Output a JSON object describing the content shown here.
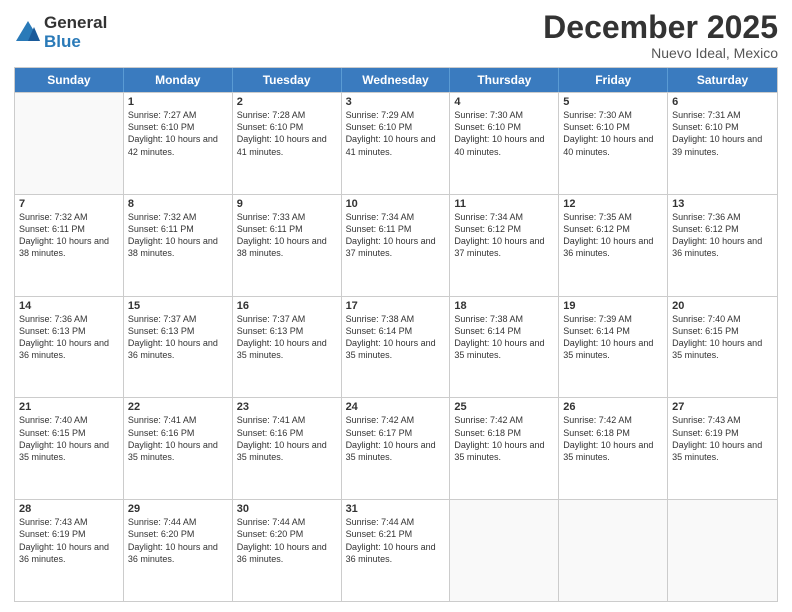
{
  "logo": {
    "general": "General",
    "blue": "Blue"
  },
  "title": "December 2025",
  "subtitle": "Nuevo Ideal, Mexico",
  "days": [
    "Sunday",
    "Monday",
    "Tuesday",
    "Wednesday",
    "Thursday",
    "Friday",
    "Saturday"
  ],
  "weeks": [
    [
      {
        "day": "",
        "info": ""
      },
      {
        "day": "1",
        "info": "Sunrise: 7:27 AM\nSunset: 6:10 PM\nDaylight: 10 hours and 42 minutes."
      },
      {
        "day": "2",
        "info": "Sunrise: 7:28 AM\nSunset: 6:10 PM\nDaylight: 10 hours and 41 minutes."
      },
      {
        "day": "3",
        "info": "Sunrise: 7:29 AM\nSunset: 6:10 PM\nDaylight: 10 hours and 41 minutes."
      },
      {
        "day": "4",
        "info": "Sunrise: 7:30 AM\nSunset: 6:10 PM\nDaylight: 10 hours and 40 minutes."
      },
      {
        "day": "5",
        "info": "Sunrise: 7:30 AM\nSunset: 6:10 PM\nDaylight: 10 hours and 40 minutes."
      },
      {
        "day": "6",
        "info": "Sunrise: 7:31 AM\nSunset: 6:10 PM\nDaylight: 10 hours and 39 minutes."
      }
    ],
    [
      {
        "day": "7",
        "info": "Sunrise: 7:32 AM\nSunset: 6:11 PM\nDaylight: 10 hours and 38 minutes."
      },
      {
        "day": "8",
        "info": "Sunrise: 7:32 AM\nSunset: 6:11 PM\nDaylight: 10 hours and 38 minutes."
      },
      {
        "day": "9",
        "info": "Sunrise: 7:33 AM\nSunset: 6:11 PM\nDaylight: 10 hours and 38 minutes."
      },
      {
        "day": "10",
        "info": "Sunrise: 7:34 AM\nSunset: 6:11 PM\nDaylight: 10 hours and 37 minutes."
      },
      {
        "day": "11",
        "info": "Sunrise: 7:34 AM\nSunset: 6:12 PM\nDaylight: 10 hours and 37 minutes."
      },
      {
        "day": "12",
        "info": "Sunrise: 7:35 AM\nSunset: 6:12 PM\nDaylight: 10 hours and 36 minutes."
      },
      {
        "day": "13",
        "info": "Sunrise: 7:36 AM\nSunset: 6:12 PM\nDaylight: 10 hours and 36 minutes."
      }
    ],
    [
      {
        "day": "14",
        "info": "Sunrise: 7:36 AM\nSunset: 6:13 PM\nDaylight: 10 hours and 36 minutes."
      },
      {
        "day": "15",
        "info": "Sunrise: 7:37 AM\nSunset: 6:13 PM\nDaylight: 10 hours and 36 minutes."
      },
      {
        "day": "16",
        "info": "Sunrise: 7:37 AM\nSunset: 6:13 PM\nDaylight: 10 hours and 35 minutes."
      },
      {
        "day": "17",
        "info": "Sunrise: 7:38 AM\nSunset: 6:14 PM\nDaylight: 10 hours and 35 minutes."
      },
      {
        "day": "18",
        "info": "Sunrise: 7:38 AM\nSunset: 6:14 PM\nDaylight: 10 hours and 35 minutes."
      },
      {
        "day": "19",
        "info": "Sunrise: 7:39 AM\nSunset: 6:14 PM\nDaylight: 10 hours and 35 minutes."
      },
      {
        "day": "20",
        "info": "Sunrise: 7:40 AM\nSunset: 6:15 PM\nDaylight: 10 hours and 35 minutes."
      }
    ],
    [
      {
        "day": "21",
        "info": "Sunrise: 7:40 AM\nSunset: 6:15 PM\nDaylight: 10 hours and 35 minutes."
      },
      {
        "day": "22",
        "info": "Sunrise: 7:41 AM\nSunset: 6:16 PM\nDaylight: 10 hours and 35 minutes."
      },
      {
        "day": "23",
        "info": "Sunrise: 7:41 AM\nSunset: 6:16 PM\nDaylight: 10 hours and 35 minutes."
      },
      {
        "day": "24",
        "info": "Sunrise: 7:42 AM\nSunset: 6:17 PM\nDaylight: 10 hours and 35 minutes."
      },
      {
        "day": "25",
        "info": "Sunrise: 7:42 AM\nSunset: 6:18 PM\nDaylight: 10 hours and 35 minutes."
      },
      {
        "day": "26",
        "info": "Sunrise: 7:42 AM\nSunset: 6:18 PM\nDaylight: 10 hours and 35 minutes."
      },
      {
        "day": "27",
        "info": "Sunrise: 7:43 AM\nSunset: 6:19 PM\nDaylight: 10 hours and 35 minutes."
      }
    ],
    [
      {
        "day": "28",
        "info": "Sunrise: 7:43 AM\nSunset: 6:19 PM\nDaylight: 10 hours and 36 minutes."
      },
      {
        "day": "29",
        "info": "Sunrise: 7:44 AM\nSunset: 6:20 PM\nDaylight: 10 hours and 36 minutes."
      },
      {
        "day": "30",
        "info": "Sunrise: 7:44 AM\nSunset: 6:20 PM\nDaylight: 10 hours and 36 minutes."
      },
      {
        "day": "31",
        "info": "Sunrise: 7:44 AM\nSunset: 6:21 PM\nDaylight: 10 hours and 36 minutes."
      },
      {
        "day": "",
        "info": ""
      },
      {
        "day": "",
        "info": ""
      },
      {
        "day": "",
        "info": ""
      }
    ]
  ]
}
